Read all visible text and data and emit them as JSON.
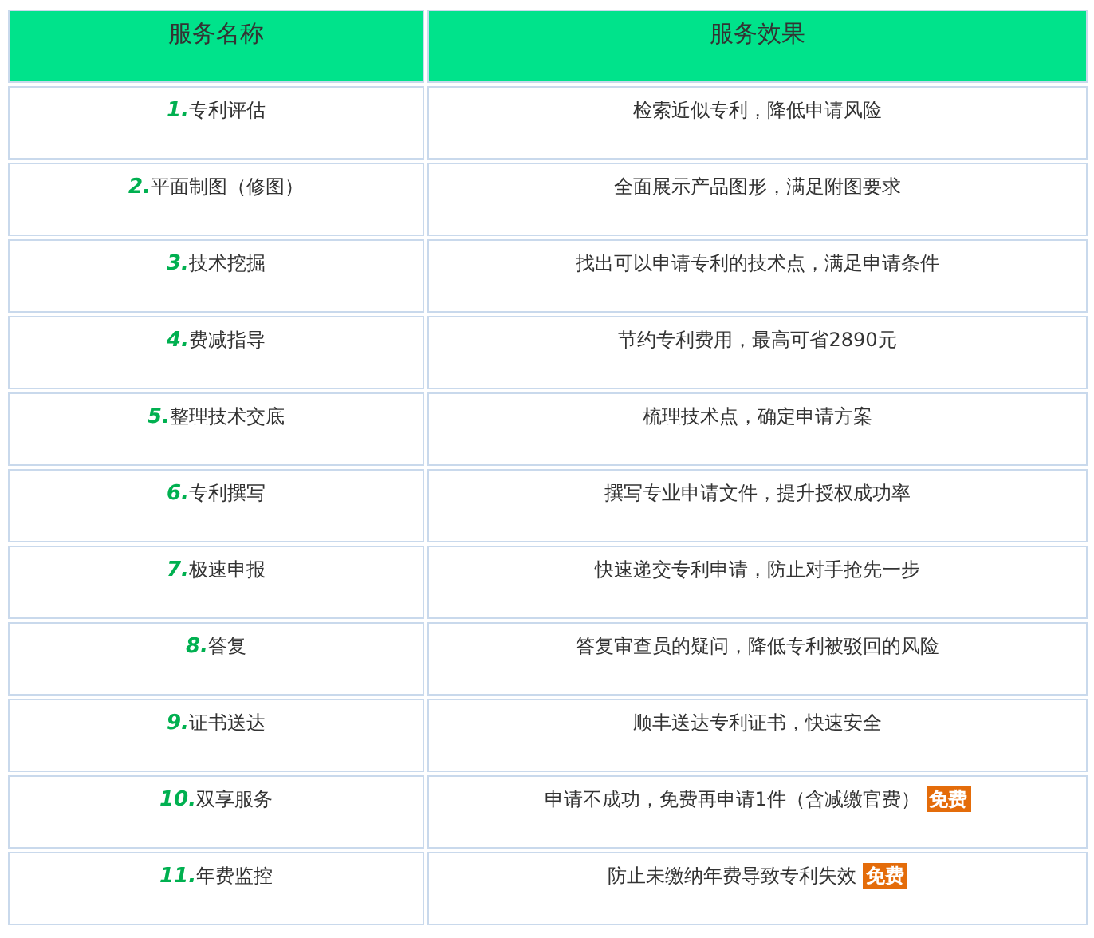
{
  "table": {
    "columns": [
      "服务名称",
      "服务效果"
    ],
    "rows": [
      {
        "number": "1.",
        "name": "专利评估",
        "effect": "检索近似专利，降低申请风险"
      },
      {
        "number": "2.",
        "name": "平面制图（修图）",
        "effect": "全面展示产品图形，满足附图要求"
      },
      {
        "number": "3.",
        "name": "技术挖掘",
        "effect": "找出可以申请专利的技术点，满足申请条件"
      },
      {
        "number": "4.",
        "name": "费减指导",
        "effect": "节约专利费用，最高可省2890元"
      },
      {
        "number": "5.",
        "name": "整理技术交底",
        "effect": "梳理技术点，确定申请方案"
      },
      {
        "number": "6.",
        "name": "专利撰写",
        "effect": "撰写专业申请文件，提升授权成功率"
      },
      {
        "number": "7.",
        "name": "极速申报",
        "effect": "快速递交专利申请，防止对手抢先一步"
      },
      {
        "number": "8.",
        "name": "答复",
        "effect": "答复审查员的疑问，降低专利被驳回的风险"
      },
      {
        "number": "9.",
        "name": "证书送达",
        "effect": "顺丰送达专利证书，快速安全"
      },
      {
        "number": "10.",
        "name": "双享服务",
        "effect": "申请不成功，免费再申请1件（含减缴官费）",
        "badge": "免费"
      },
      {
        "number": "11.",
        "name": "年费监控",
        "effect": "防止未缴纳年费导致专利失效",
        "badge": "免费"
      }
    ]
  }
}
